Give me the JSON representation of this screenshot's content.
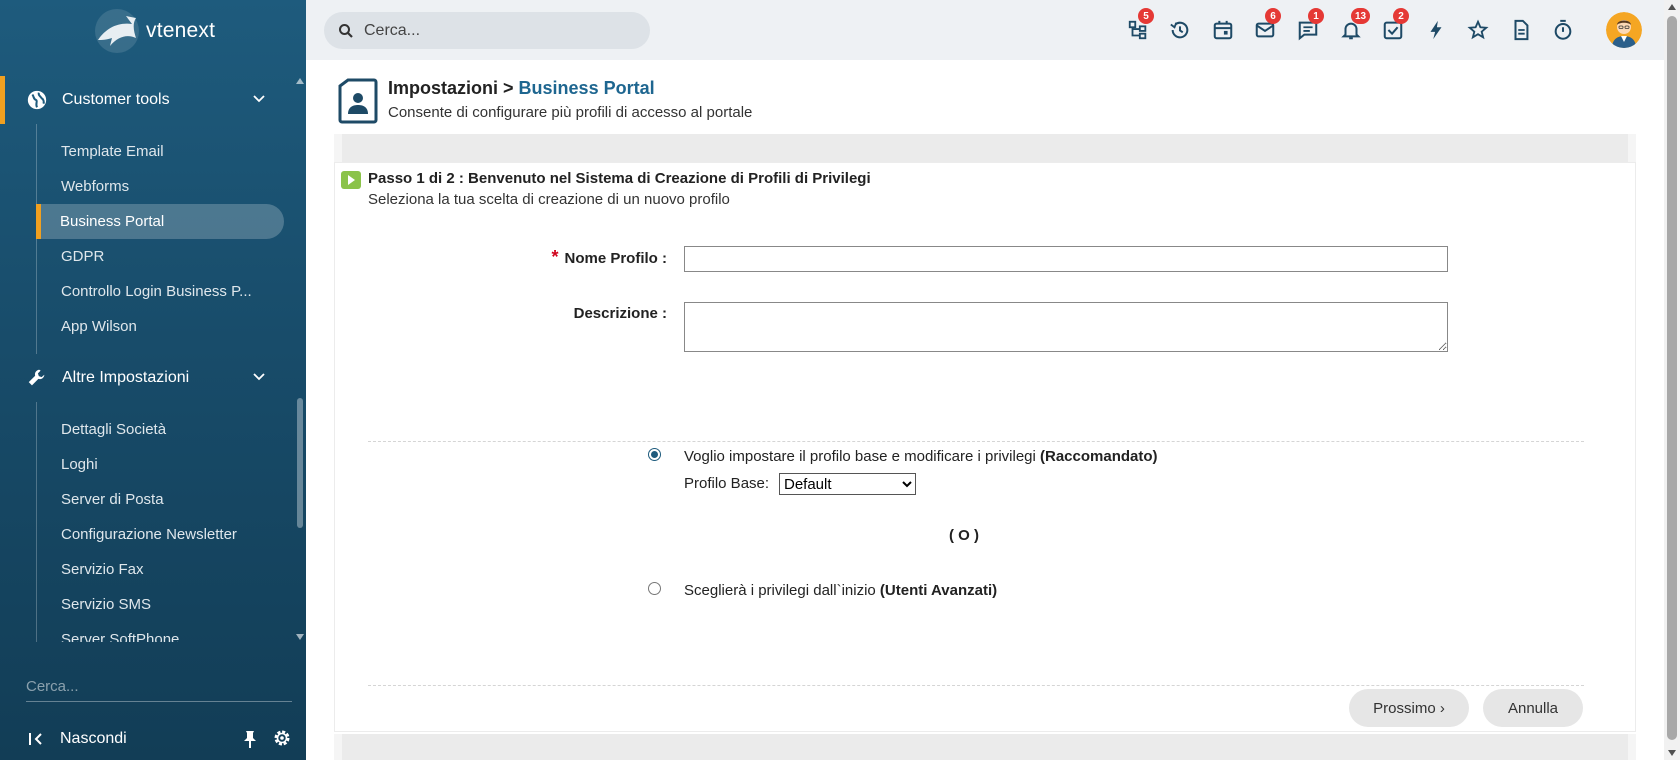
{
  "app": {
    "logo_text": "vtenext"
  },
  "sidebar": {
    "sections": [
      {
        "label": "Customer tools",
        "icon": "globe-icon",
        "items": [
          "Template Email",
          "Webforms",
          "Business Portal",
          "GDPR",
          "Controllo Login Business P...",
          "App Wilson"
        ],
        "selected": "Business Portal"
      },
      {
        "label": "Altre Impostazioni",
        "icon": "wrench-icon",
        "items": [
          "Dettagli Società",
          "Loghi",
          "Server di Posta",
          "Configurazione Newsletter",
          "Servizio Fax",
          "Servizio SMS",
          "Server SoftPhone"
        ]
      }
    ],
    "search_placeholder": "Cerca...",
    "hide_label": "Nascondi"
  },
  "topbar": {
    "search_placeholder": "Cerca...",
    "icons": [
      {
        "name": "hierarchy-icon",
        "badge": "5"
      },
      {
        "name": "history-icon",
        "badge": ""
      },
      {
        "name": "calendar-icon",
        "badge": ""
      },
      {
        "name": "mail-icon",
        "badge": "6"
      },
      {
        "name": "chat-icon",
        "badge": "1"
      },
      {
        "name": "bell-icon",
        "badge": "13"
      },
      {
        "name": "tasks-icon",
        "badge": "2"
      },
      {
        "name": "lightning-icon",
        "badge": ""
      },
      {
        "name": "star-icon",
        "badge": ""
      },
      {
        "name": "document-icon",
        "badge": ""
      },
      {
        "name": "timer-icon",
        "badge": ""
      }
    ],
    "badge_color": "#e53935"
  },
  "header": {
    "crumb_root": "Impostazioni >",
    "crumb_current": "Business Portal",
    "subtitle": "Consente di configurare più profili di accesso al portale"
  },
  "wizard": {
    "step_title": "Passo 1 di 2 : Benvenuto nel Sistema di Creazione di Profili di Privilegi",
    "step_subtitle": "Seleziona la tua scelta di creazione di un nuovo profilo",
    "name_label": "Nome Profilo :",
    "name_required": "*",
    "name_value": "",
    "description_label": "Descrizione :",
    "description_value": "",
    "option1_text": "Voglio impostare il profilo base e modificare i privilegi",
    "option1_bold": "(Raccomandato)",
    "base_profile_label": "Profilo Base:",
    "base_profile_selected": "Default",
    "or_text": "( O )",
    "option2_text": "Sceglierà i privilegi dall`inizio",
    "option2_bold": "(Utenti Avanzati)",
    "next_label": "Prossimo ›",
    "cancel_label": "Annulla"
  },
  "colors": {
    "sidebar": "#1e5b7d",
    "accent": "#f0a020",
    "link": "#1e6690"
  }
}
